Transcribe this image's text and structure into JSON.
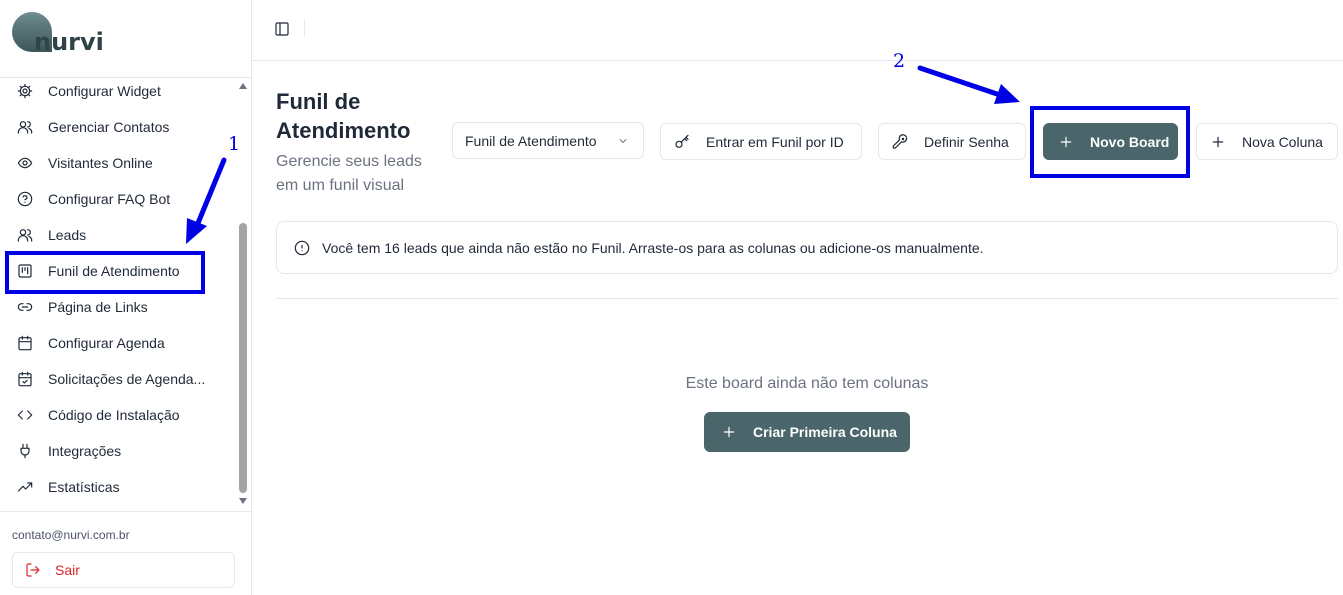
{
  "sidebar": {
    "brand": "nurvi",
    "items": [
      {
        "label": "Configurar Widget",
        "icon": "gear-icon"
      },
      {
        "label": "Gerenciar Contatos",
        "icon": "users-icon"
      },
      {
        "label": "Visitantes Online",
        "icon": "eye-icon"
      },
      {
        "label": "Configurar FAQ Bot",
        "icon": "help-circle-icon"
      },
      {
        "label": "Leads",
        "icon": "users-icon"
      },
      {
        "label": "Funil de Atendimento",
        "icon": "kanban-icon"
      },
      {
        "label": "Página de Links",
        "icon": "link-icon"
      },
      {
        "label": "Configurar Agenda",
        "icon": "calendar-icon"
      },
      {
        "label": "Solicitações de Agenda...",
        "icon": "calendar-check-icon"
      },
      {
        "label": "Código de Instalação",
        "icon": "code-icon"
      },
      {
        "label": "Integrações",
        "icon": "plug-icon"
      },
      {
        "label": "Estatísticas",
        "icon": "trending-up-icon"
      }
    ],
    "active_item": "Funil de Atendimento",
    "user_email": "contato@nurvi.com.br",
    "logout_label": "Sair"
  },
  "header": {
    "title": "Funil de Atendimento",
    "subtitle": "Gerencie seus leads em um funil visual"
  },
  "toolbar": {
    "board_select": "Funil de Atendimento",
    "enter_label": "Entrar em Funil por ID",
    "password_label": "Definir Senha",
    "new_board_label": "Novo Board",
    "new_column_label": "Nova Coluna"
  },
  "alert": {
    "message": "Você tem 16 leads que ainda não estão no Funil. Arraste-os para as colunas ou adicione-os manualmente."
  },
  "empty_state": {
    "message": "Este board ainda não tem colunas",
    "button_label": "Criar Primeira Coluna"
  },
  "annotations": {
    "step1": "1",
    "step2": "2",
    "color": "#0000e6"
  },
  "colors": {
    "primary": "#4a666a",
    "danger": "#dc2626",
    "border": "#e5e7eb"
  }
}
